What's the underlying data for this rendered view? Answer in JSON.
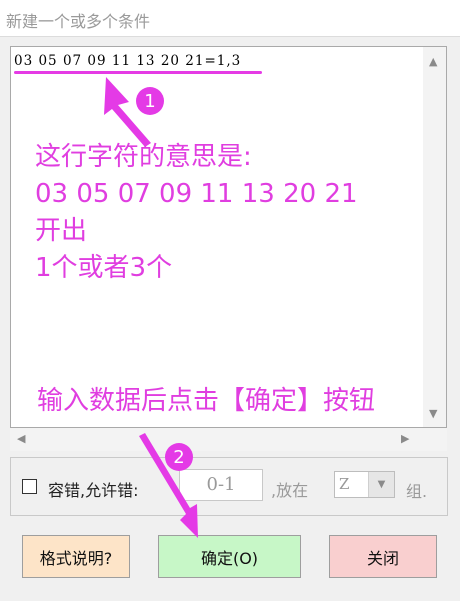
{
  "window": {
    "title": "新建一个或多个条件"
  },
  "editor": {
    "code_line": "03 05 07 09 11 13 20 21=1,3",
    "callout1_number": "1",
    "note_lines": [
      "这行字符的意思是:",
      "03 05 07 09 11 13 20 21",
      "开出",
      "1个或者3个"
    ],
    "instruction": "输入数据后点击【确定】按钮"
  },
  "options": {
    "tolerance_label": "容错,允许错:",
    "tolerance_value": "0-1",
    "at_label": ",放在",
    "group_select_value": "Z",
    "group_suffix": "组."
  },
  "buttons": {
    "help_label": "格式说明?",
    "ok_label": "确定(O)",
    "close_label": "关闭"
  },
  "callout2_number": "2",
  "icons": {
    "scroll_up": "triangle-up-icon",
    "scroll_down": "triangle-down-icon",
    "scroll_left": "triangle-left-icon",
    "scroll_right": "triangle-right-icon",
    "dropdown": "chevron-down-icon"
  },
  "colors": {
    "annotation": "#e43ae6",
    "help_button": "#fde4c8",
    "ok_button": "#c7f7c7",
    "close_button": "#f9cfcf"
  }
}
